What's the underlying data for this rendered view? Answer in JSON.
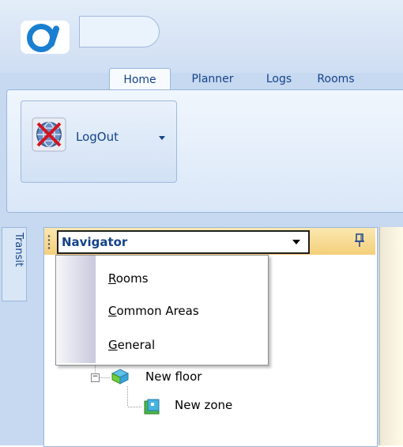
{
  "tabs": [
    {
      "label": "Home"
    },
    {
      "label": "Planner"
    },
    {
      "label": "Logs"
    },
    {
      "label": "Rooms"
    }
  ],
  "ribbon": {
    "logout_label": "LogOut"
  },
  "side_tab": {
    "label": "Transit"
  },
  "navigator": {
    "title": "Navigator",
    "pin_glyph": "1̵"
  },
  "menu": {
    "items": [
      {
        "label_u": "R",
        "label_rest": "ooms"
      },
      {
        "label_u": "C",
        "label_rest": "ommon Areas"
      },
      {
        "label_u": "G",
        "label_rest": "eneral"
      }
    ]
  },
  "tree": {
    "floor": {
      "label": "New floor",
      "expander": "−"
    },
    "zone": {
      "label": "New zone"
    }
  },
  "colors": {
    "accent": "#15428b",
    "header": "#f4cf7a",
    "logo": "#1a7fd0"
  }
}
